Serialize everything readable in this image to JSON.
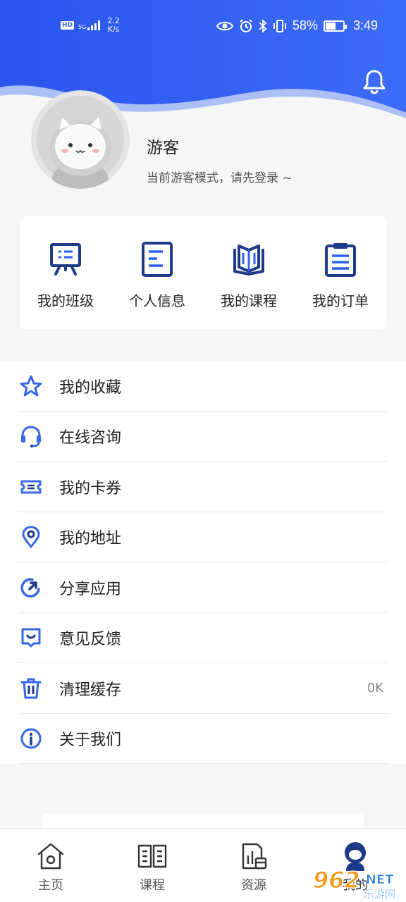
{
  "status_bar": {
    "hd_badge": "HD",
    "signal": "5G",
    "net_speed_value": "2.2",
    "net_speed_unit": "K/s",
    "battery": "58%",
    "battery_level": 0.58,
    "time": "3:49"
  },
  "header": {
    "bell_icon": "bell-icon"
  },
  "profile": {
    "name": "游客",
    "subtitle": "当前游客模式，请先登录 ~"
  },
  "quick_actions": [
    {
      "label": "我的班级",
      "icon": "class-board-icon"
    },
    {
      "label": "个人信息",
      "icon": "document-icon"
    },
    {
      "label": "我的课程",
      "icon": "open-book-icon"
    },
    {
      "label": "我的订单",
      "icon": "clipboard-icon"
    }
  ],
  "menu": [
    {
      "label": "我的收藏",
      "icon": "star-icon",
      "value": ""
    },
    {
      "label": "在线咨询",
      "icon": "headset-icon",
      "value": ""
    },
    {
      "label": "我的卡券",
      "icon": "ticket-icon",
      "value": ""
    },
    {
      "label": "我的地址",
      "icon": "location-pin-icon",
      "value": ""
    },
    {
      "label": "分享应用",
      "icon": "share-icon",
      "value": ""
    },
    {
      "label": "意见反馈",
      "icon": "feedback-icon",
      "value": ""
    },
    {
      "label": "清理缓存",
      "icon": "trash-icon",
      "value": "0K"
    },
    {
      "label": "关于我们",
      "icon": "info-icon",
      "value": ""
    }
  ],
  "tabs": [
    {
      "label": "主页",
      "icon": "home-icon",
      "active": false
    },
    {
      "label": "课程",
      "icon": "book-icon",
      "active": false
    },
    {
      "label": "资源",
      "icon": "resource-icon",
      "active": false
    },
    {
      "label": "我的",
      "icon": "profile-icon",
      "active": true
    }
  ],
  "watermark": {
    "brand": "962",
    "domain": ".NET",
    "sub": "乐游网"
  },
  "colors": {
    "primary": "#2f5ff0",
    "icon_navy": "#1e3a8a",
    "menu_icon_blue": "#3567e6"
  }
}
